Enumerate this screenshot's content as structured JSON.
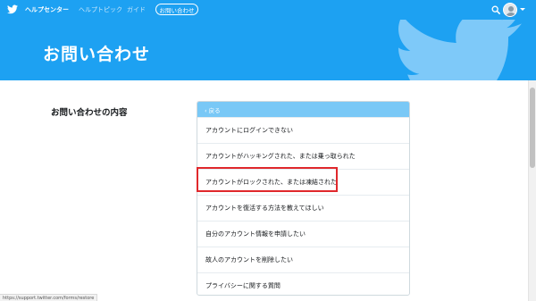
{
  "brand": {
    "logo": "twitter-bird-icon",
    "accent_color": "#1da1f2",
    "highlight_color": "#e0282c"
  },
  "nav": {
    "help_center": "ヘルプセンター",
    "help_topics": "ヘルプトピック",
    "guides": "ガイド",
    "contact_us": "お問い合わせ"
  },
  "header": {
    "search_icon": "search-icon",
    "avatar_icon": "avatar-icon"
  },
  "hero": {
    "title": "お問い合わせ"
  },
  "form": {
    "section_label": "お問い合わせの内容",
    "back_label": "‹ 戻る",
    "options": [
      {
        "label": "アカウントにログインできない"
      },
      {
        "label": "アカウントがハッキングされた、または乗っ取られた"
      },
      {
        "label": "アカウントがロックされた、または凍結された"
      },
      {
        "label": "アカウントを復活する方法を教えてほしい"
      },
      {
        "label": "自分のアカウント情報を申請したい"
      },
      {
        "label": "故人のアカウントを削除したい"
      },
      {
        "label": "プライバシーに関する質問"
      }
    ]
  },
  "status_bar": {
    "url": "https://support.twitter.com/forms/restore"
  }
}
